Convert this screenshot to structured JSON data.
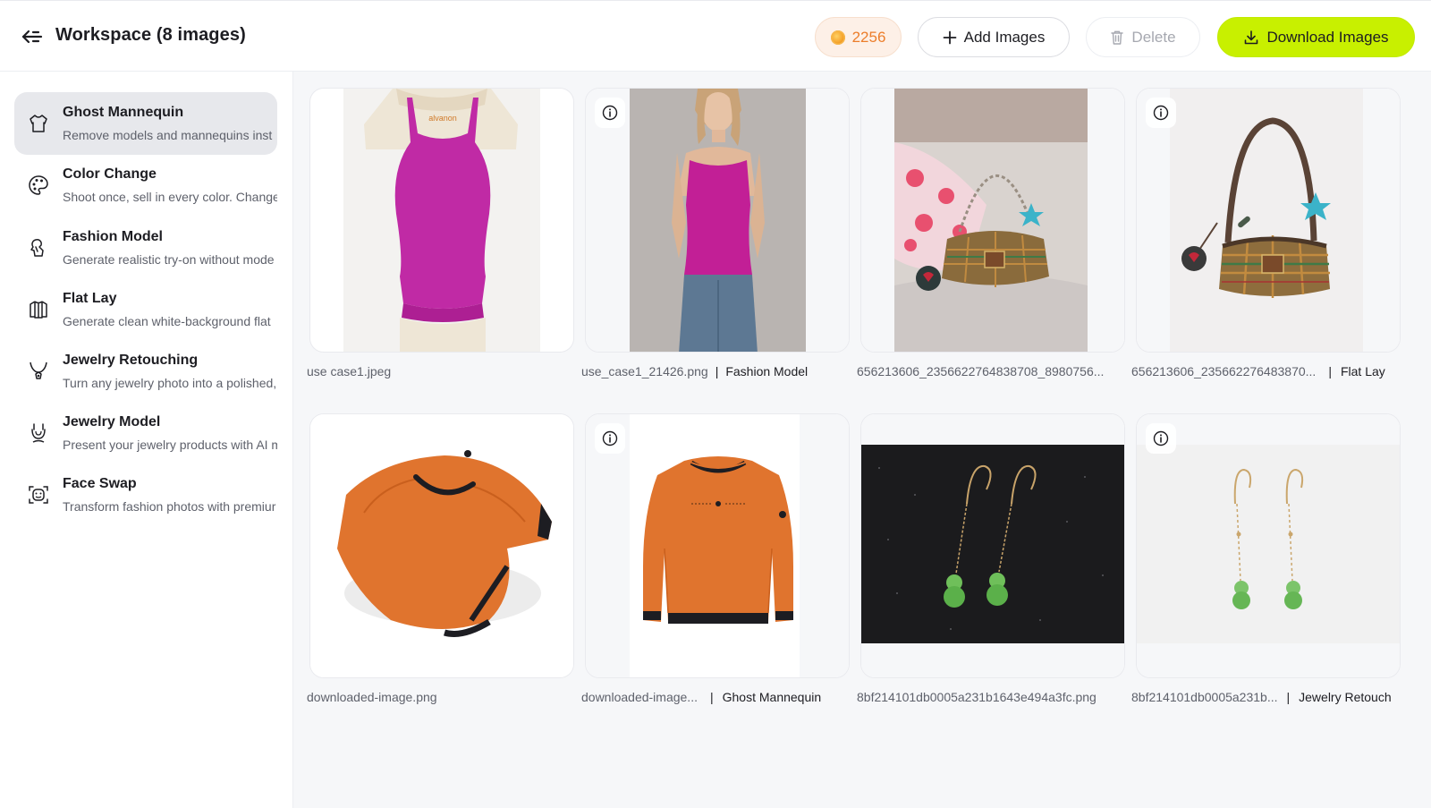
{
  "header": {
    "title": "Workspace (8 images)",
    "credits": "2256",
    "add_label": "Add Images",
    "delete_label": "Delete",
    "download_label": "Download Images"
  },
  "colors": {
    "accent": "#c8f000",
    "credits_text": "#ec7d2a",
    "credits_bg": "#fdf0e7",
    "sidebar_active": "#e7e8ec",
    "canvas_bg": "#f6f7f9"
  },
  "sidebar": {
    "items": [
      {
        "name": "Ghost Mannequin",
        "desc": "Remove models and mannequins inst",
        "icon": "ghost-mannequin-icon",
        "active": true
      },
      {
        "name": "Color Change",
        "desc": "Shoot once, sell in every color. Change",
        "icon": "palette-icon",
        "active": false
      },
      {
        "name": "Fashion Model",
        "desc": "Generate realistic try-on without mode",
        "icon": "fashion-model-icon",
        "active": false
      },
      {
        "name": "Flat Lay",
        "desc": "Generate clean white-background flat",
        "icon": "flat-lay-icon",
        "active": false
      },
      {
        "name": "Jewelry Retouching",
        "desc": "Turn any jewelry photo into a polished,",
        "icon": "necklace-icon",
        "active": false
      },
      {
        "name": "Jewelry Model",
        "desc": "Present your jewelry products with AI m",
        "icon": "jewelry-model-icon",
        "active": false
      },
      {
        "name": "Face Swap",
        "desc": "Transform fashion photos with premiur",
        "icon": "face-swap-icon",
        "active": false
      }
    ]
  },
  "images": [
    {
      "filename": "use case1.jpeg",
      "tag": "",
      "has_info": false,
      "subject": "magenta tank top on mannequin"
    },
    {
      "filename": "use_case1_21426.png",
      "tag": "Fashion Model",
      "has_info": true,
      "subject": "model wearing magenta tank top"
    },
    {
      "filename": "656213606_2356622764838708_8980756...",
      "tag": "",
      "has_info": false,
      "subject": "plaid handbag on bed"
    },
    {
      "filename": "656213606_235662276483870...",
      "tag": "Flat Lay",
      "has_info": true,
      "subject": "plaid handbag flat lay"
    },
    {
      "filename": "downloaded-image.png",
      "tag": "",
      "has_info": false,
      "subject": "orange sweatshirt"
    },
    {
      "filename": "downloaded-image...",
      "tag": "Ghost Mannequin",
      "has_info": true,
      "subject": "orange sweatshirt ghost mannequin"
    },
    {
      "filename": "8bf214101db0005a231b1643e494a3fc.png",
      "tag": "",
      "has_info": false,
      "subject": "jade earrings on black"
    },
    {
      "filename": "8bf214101db0005a231b...",
      "tag": "Jewelry Retouch",
      "has_info": true,
      "subject": "jade earrings retouched"
    }
  ]
}
